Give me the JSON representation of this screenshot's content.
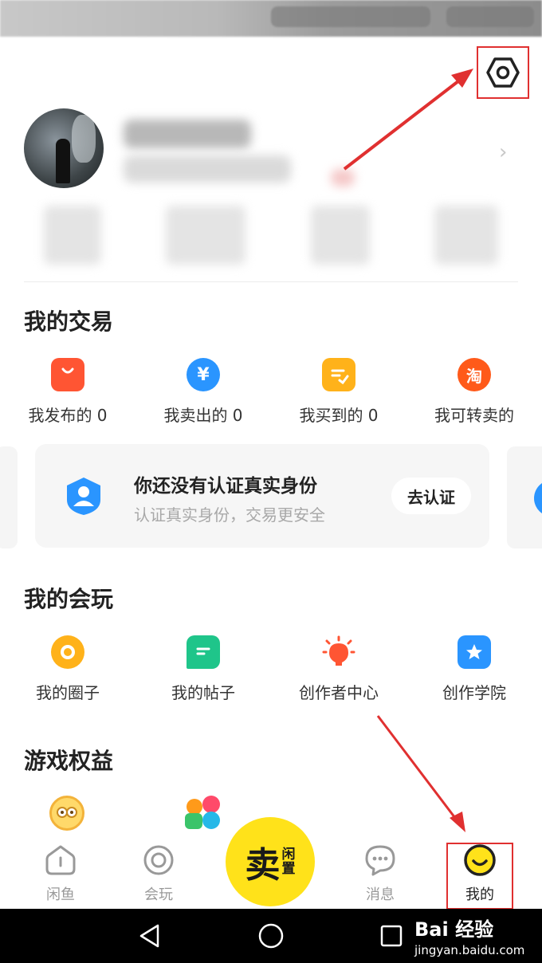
{
  "trade": {
    "title": "我的交易",
    "items": [
      {
        "label": "我发布的 0",
        "icon": "shopping-bag-icon",
        "color": "#ff5533"
      },
      {
        "label": "我卖出的 0",
        "icon": "yen-icon",
        "color": "#2a95ff"
      },
      {
        "label": "我买到的 0",
        "icon": "order-check-icon",
        "color": "#ffb21a"
      },
      {
        "label": "我可转卖的",
        "icon": "taobao-icon",
        "color": "#ff5a1a",
        "glyph": "淘"
      }
    ]
  },
  "verify_card": {
    "title": "你还没有认证真实身份",
    "subtitle": "认证真实身份，交易更安全",
    "button": "去认证"
  },
  "play": {
    "title": "我的会玩",
    "items": [
      {
        "label": "我的圈子",
        "icon": "circle-icon",
        "color": "#ffb21a"
      },
      {
        "label": "我的帖子",
        "icon": "post-icon",
        "color": "#1fc58a"
      },
      {
        "label": "创作者中心",
        "icon": "lightbulb-icon",
        "color": "#ff5533"
      },
      {
        "label": "创作学院",
        "icon": "star-icon",
        "color": "#2a95ff"
      }
    ]
  },
  "game": {
    "title": "游戏权益"
  },
  "tabbar": {
    "tabs": [
      {
        "label": "闲鱼",
        "icon": "fish-home-icon"
      },
      {
        "label": "会玩",
        "icon": "target-icon"
      },
      {
        "label": "消息",
        "icon": "chat-bubble-icon"
      },
      {
        "label": "我的",
        "icon": "smiley-icon"
      }
    ],
    "sell": {
      "big": "卖",
      "small_top": "闲",
      "small_bottom": "置"
    }
  },
  "watermark": {
    "line1": "Bai 经验",
    "line2": "jingyan.baidu.com"
  },
  "colors": {
    "accent": "#ffe21a",
    "annotation": "#e03030"
  }
}
